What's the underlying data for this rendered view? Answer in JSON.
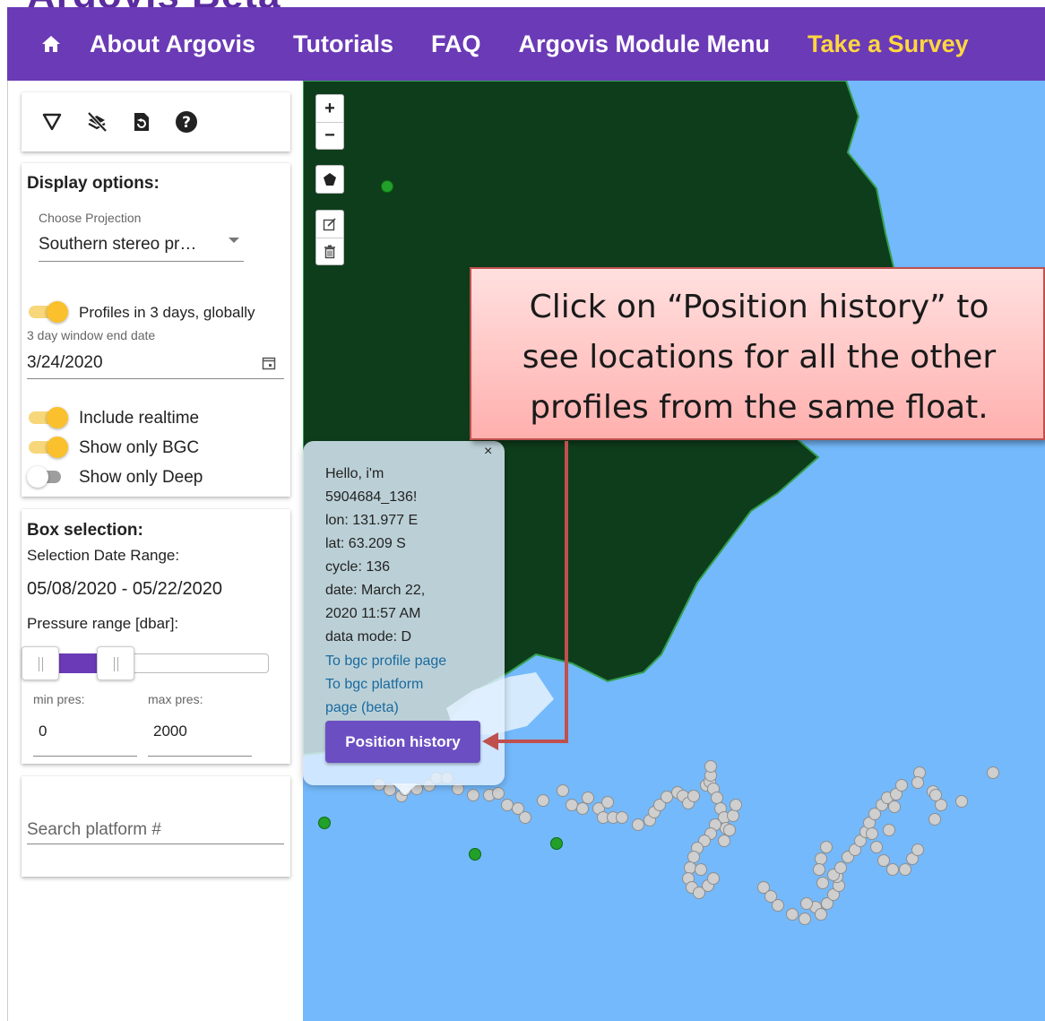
{
  "top_strip_text": "Argovis Beta",
  "nav": {
    "home_icon": "home-icon",
    "links": [
      "About Argovis",
      "Tutorials",
      "FAQ",
      "Argovis Module Menu"
    ],
    "survey": "Take a Survey"
  },
  "tools": {
    "icons": [
      "filter-triangle-icon",
      "layers-off-icon",
      "reset-icon",
      "help-icon"
    ]
  },
  "display_options": {
    "title": "Display options:",
    "projection_label": "Choose Projection",
    "projection_value": "Southern stereo pr…",
    "profiles_toggle_label": "Profiles in 3 days, globally",
    "window_label": "3 day window end date",
    "window_date": "3/24/2020",
    "include_realtime": "Include realtime",
    "show_bgc": "Show only BGC",
    "show_deep": "Show only Deep",
    "toggles": {
      "profiles": true,
      "realtime": true,
      "bgc": true,
      "deep": false
    }
  },
  "box_selection": {
    "title": "Box selection:",
    "date_range_label": "Selection Date Range:",
    "date_range": "05/08/2020 - 05/22/2020",
    "pressure_label": "Pressure range [dbar]:",
    "min_label": "min pres:",
    "max_label": "max pres:",
    "min_value": "0",
    "max_value": "2000"
  },
  "search": {
    "placeholder": "Search platform #"
  },
  "map": {
    "zoom_in": "+",
    "zoom_out": "−",
    "colors": {
      "ocean": "#74b9fb",
      "land": "#0e3d1c",
      "coast": "#33a050",
      "profile": "#cfcfcf",
      "float": "#22a02a"
    }
  },
  "popup": {
    "close": "×",
    "lines": [
      "Hello, i'm",
      "5904684_136!",
      "lon: 131.977 E",
      "lat: 63.209 S",
      "cycle: 136",
      "date: March 22,",
      "2020 11:57 AM",
      "data mode: D"
    ],
    "links": [
      "To bgc profile page",
      "To bgc platform",
      "page (beta)"
    ],
    "button": "Position history"
  },
  "callout": {
    "lines": [
      "Click on “Position history” to",
      "see locations for all the other",
      "profiles from the same float."
    ],
    "border_color": "#c0504d"
  }
}
